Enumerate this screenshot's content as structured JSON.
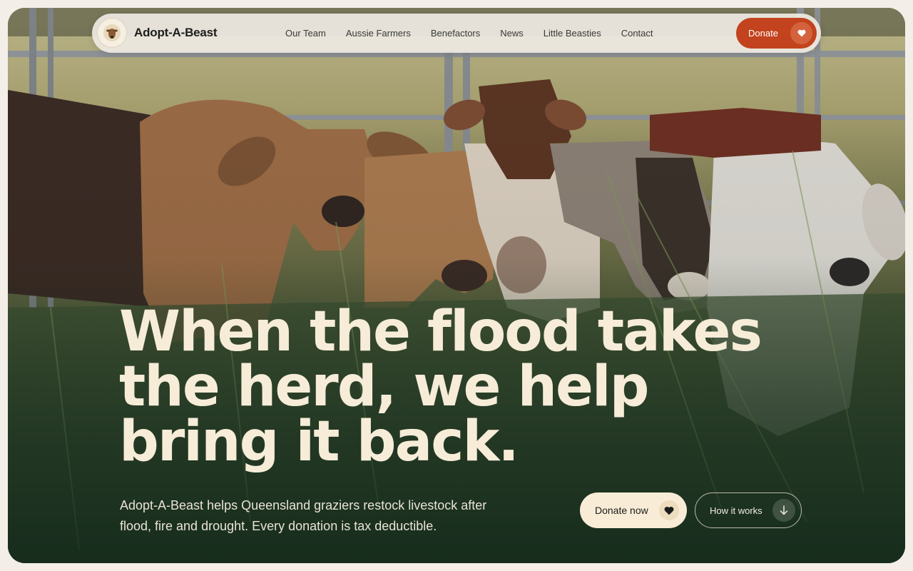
{
  "brand": {
    "name": "Adopt-A-Beast",
    "logo_icon": "cow-badge-icon"
  },
  "nav": {
    "links": [
      "Our Team",
      "Aussie Farmers",
      "Benefactors",
      "News",
      "Little Beasties",
      "Contact"
    ],
    "donate_label": "Donate",
    "donate_icon": "heart-icon"
  },
  "hero": {
    "headline_lines": [
      "When the flood takes",
      "the herd, we help",
      "bring it back."
    ],
    "subtext": "Adopt-A-Beast helps Queensland graziers restock livestock after flood, fire and drought. Every donation is tax deductible.",
    "primary_cta": {
      "label": "Donate now",
      "icon": "heart-icon"
    },
    "secondary_cta": {
      "label": "How it works",
      "icon": "arrow-down-icon"
    }
  },
  "colors": {
    "accent": "#c2431d",
    "cream": "#f8ecd6",
    "headline": "#f6ecd8"
  }
}
